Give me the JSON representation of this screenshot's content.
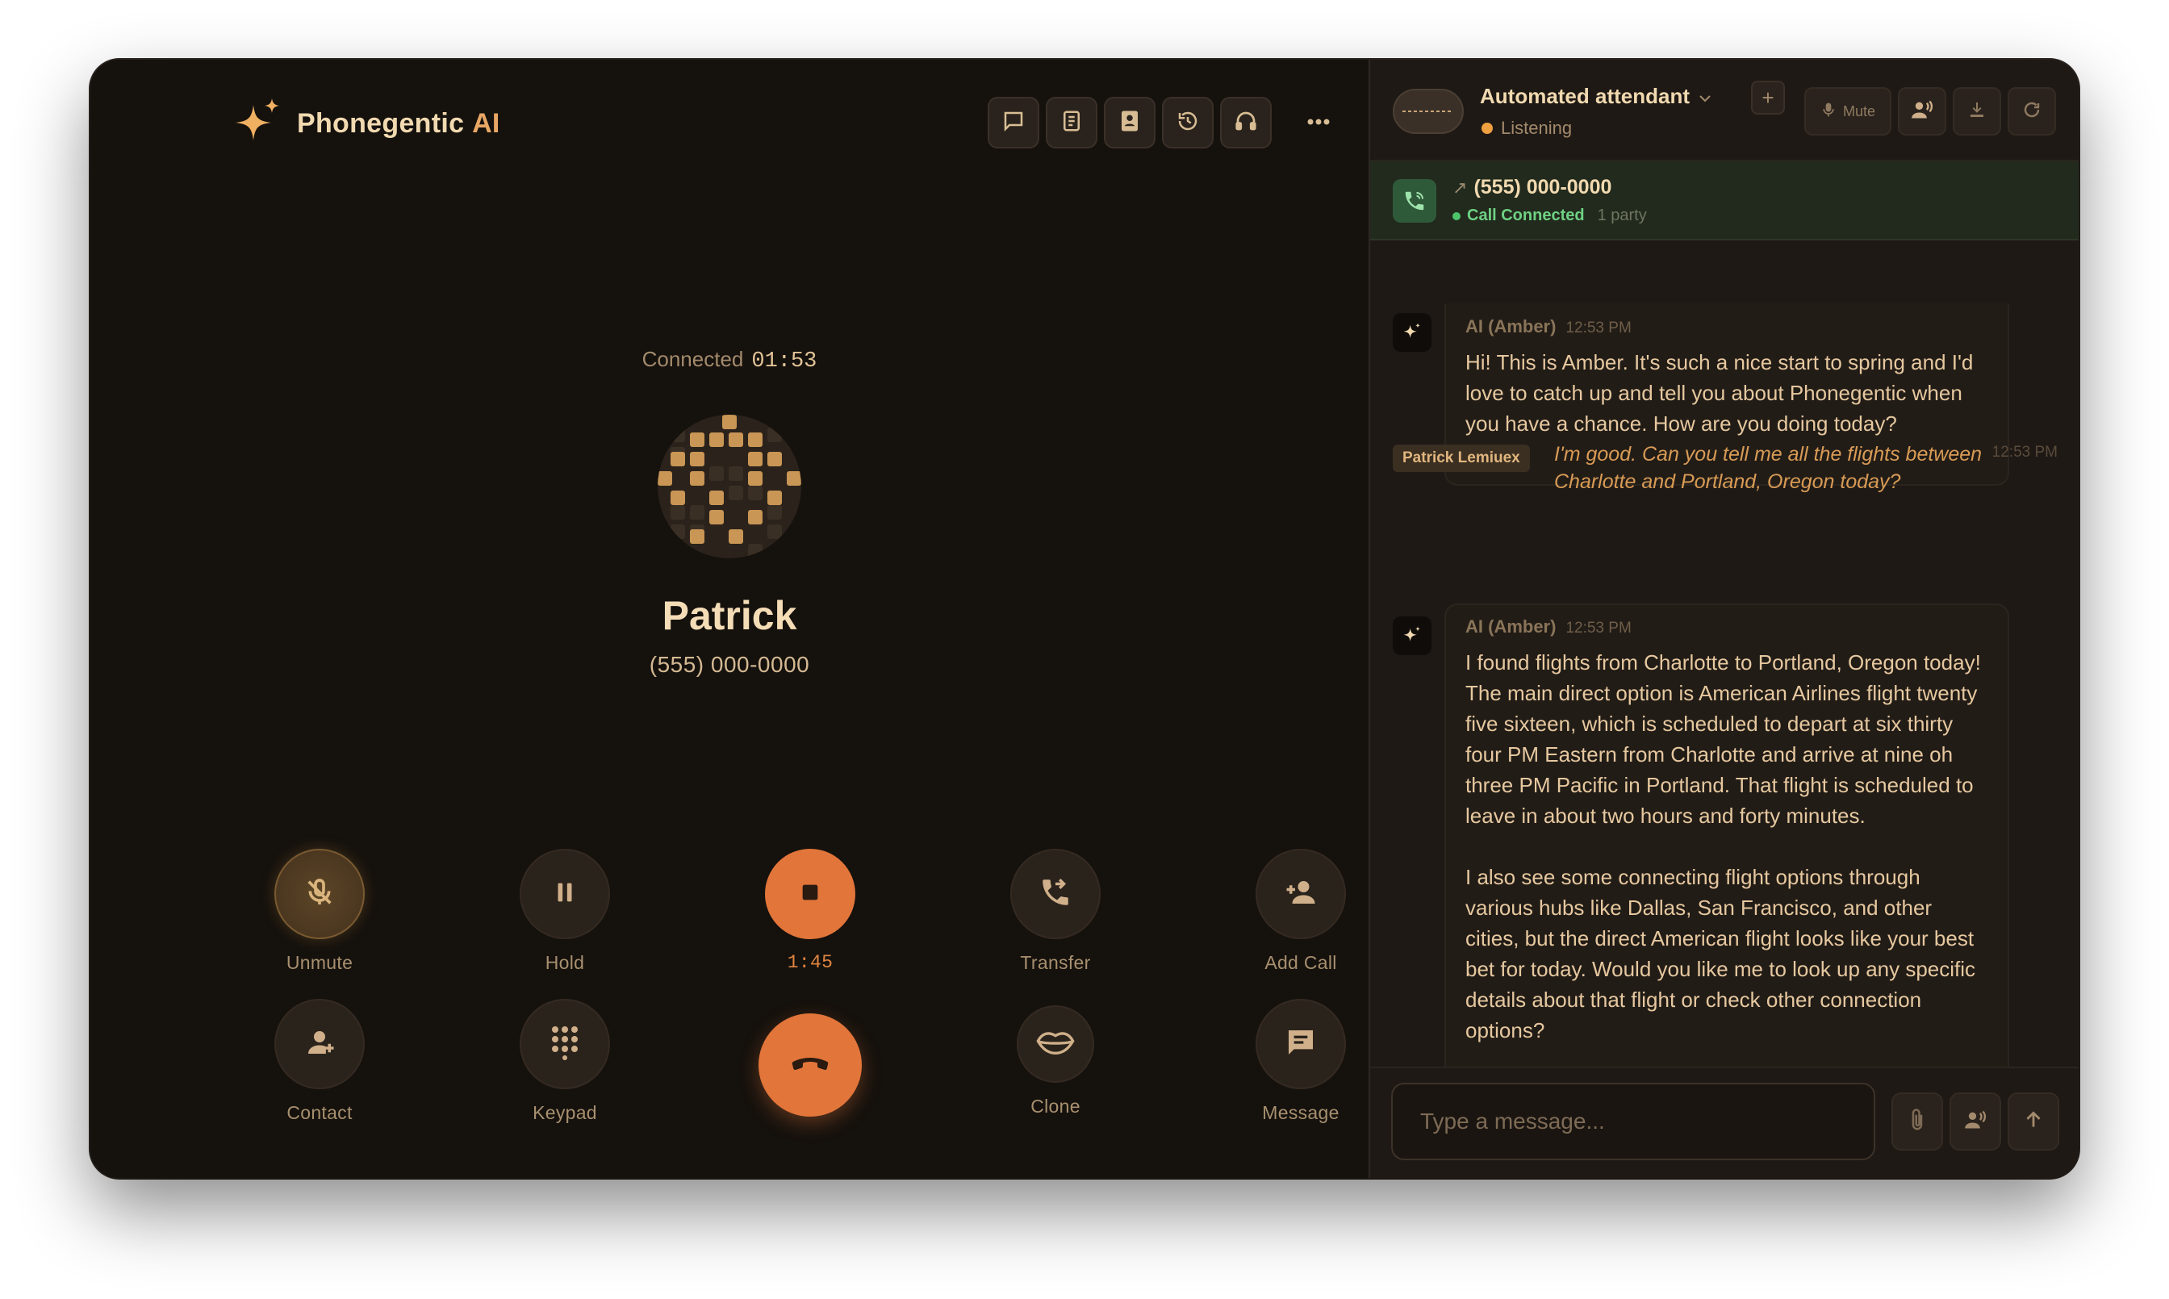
{
  "app": {
    "brand": "Phonegentic",
    "brand_suffix": "AI"
  },
  "toolbar": {
    "icons": [
      "chat-icon",
      "notes-icon",
      "contacts-icon",
      "history-icon",
      "headset-icon",
      "more-icon"
    ]
  },
  "call": {
    "status_label": "Connected",
    "elapsed": "01:53",
    "caller_name": "Patrick",
    "caller_number": "(555) 000-0000"
  },
  "controls": {
    "unmute": "Unmute",
    "hold": "Hold",
    "record_timer": "1:45",
    "transfer": "Transfer",
    "add_call": "Add Call",
    "contact": "Contact",
    "keypad": "Keypad",
    "clone": "Clone",
    "message": "Message"
  },
  "agent": {
    "title": "Automated attendant",
    "status": "Listening",
    "plus": "+",
    "mute_label": "Mute"
  },
  "callbar": {
    "number": "(555) 000-0000",
    "state": "Call Connected",
    "parties": "1 party"
  },
  "transcript": {
    "m1": {
      "speaker": "AI (Amber)",
      "time": "12:53 PM",
      "text": "Hi! This is Amber. It's such a nice start to spring and I'd love to catch up and tell you about Phonegentic when you have a chance. How are you doing today?"
    },
    "m2": {
      "speaker": "Patrick Lemiuex",
      "time": "12:53 PM",
      "text": "I'm good. Can you tell me all the flights between Charlotte and Portland, Oregon today?"
    },
    "m3": {
      "speaker": "AI (Amber)",
      "time": "12:53 PM",
      "text": "I found flights from Charlotte to Portland, Oregon today! The main direct option is American Airlines flight twenty five sixteen, which is scheduled to depart at six thirty four PM Eastern from Charlotte and arrive at nine oh three PM Pacific in Portland. That flight is scheduled to leave in about two hours and forty minutes.\n\nI also see some connecting flight options through various hubs like Dallas, San Francisco, and other cities, but the direct American flight looks like your best bet for today. Would you like me to look up any specific details about that flight or check other connection options?"
    }
  },
  "composer": {
    "placeholder": "Type a message..."
  },
  "colors": {
    "accent": "#e2753a",
    "gold": "#e8a765",
    "background": "#15110d",
    "connected": "#4ec46a"
  }
}
